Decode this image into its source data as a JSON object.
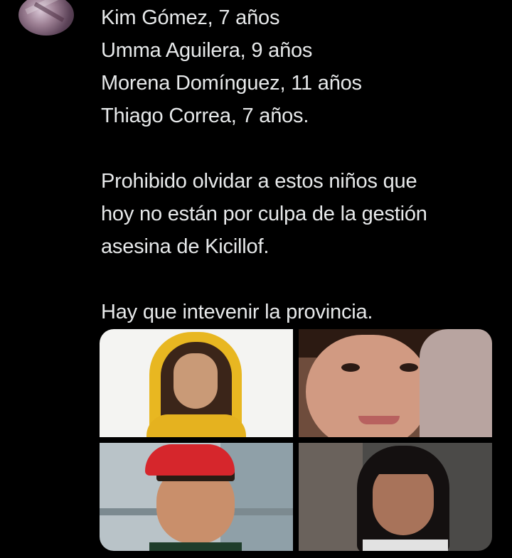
{
  "tweet": {
    "lines_block1": [
      "Kim Gómez, 7 años",
      "Umma Aguilera, 9 años",
      "Morena Domínguez, 11 años",
      "Thiago Correa, 7 años."
    ],
    "lines_block2": [
      "Prohibido olvidar a estos niños que",
      "hoy no están por culpa de la gestión",
      "asesina de Kicillof."
    ],
    "lines_block3": [
      "Hay que intevenir la provincia."
    ]
  },
  "colors": {
    "background": "#000000",
    "text": "#e7e9ea"
  },
  "media": {
    "photo_count": 4
  }
}
